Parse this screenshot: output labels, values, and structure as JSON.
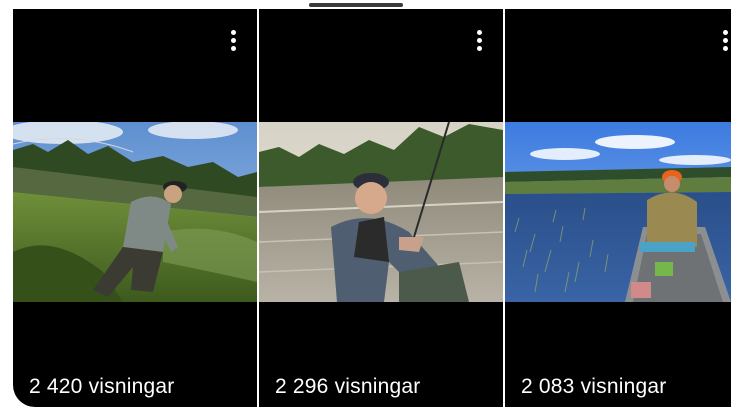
{
  "videos": [
    {
      "views": "2 420 visningar",
      "thumbnail_icon": "fishing-shore-thumbnail",
      "menu_icon": "more-vertical-icon"
    },
    {
      "views": "2 296 visningar",
      "thumbnail_icon": "fishing-boat-rod-thumbnail",
      "menu_icon": "more-vertical-icon"
    },
    {
      "views": "2 083 visningar",
      "thumbnail_icon": "fishing-canoe-lake-thumbnail",
      "menu_icon": "more-vertical-icon"
    }
  ],
  "colors": {
    "card_background": "#000000",
    "text": "#ffffff",
    "page_background": "#ffffff"
  }
}
